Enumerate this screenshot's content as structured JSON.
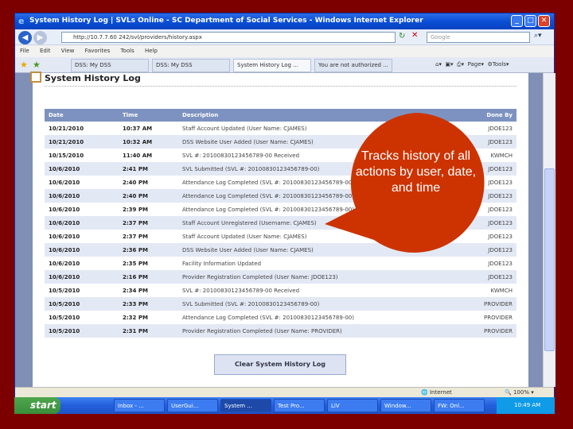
{
  "window": {
    "title": "System History Log | SVLs Online - SC Department of Social Services - Windows Internet Explorer",
    "url": "http://10.7.7.60 242/svl/providers/history.aspx",
    "search_placeholder": "Google"
  },
  "menu": [
    "File",
    "Edit",
    "View",
    "Favorites",
    "Tools",
    "Help"
  ],
  "tabs": [
    "DSS: My DSS",
    "DSS: My DSS",
    "System History Log ...",
    "You are not authorized ..."
  ],
  "toolbar": {
    "page": "Page",
    "tools": "Tools"
  },
  "page": {
    "title": "System History Log",
    "clear_button": "Clear System History Log"
  },
  "table": {
    "headers": [
      "Date",
      "Time",
      "Description",
      "Done By"
    ],
    "rows": [
      [
        "10/21/2010",
        "10:37 AM",
        "Staff Account Updated (User Name: CJAMES)",
        "JDOE123"
      ],
      [
        "10/21/2010",
        "10:32 AM",
        "DSS Website User Added (User Name: CJAMES)",
        "JDOE123"
      ],
      [
        "10/15/2010",
        "11:40 AM",
        "SVL #: 20100830123456789-00 Received",
        "KWMCH"
      ],
      [
        "10/6/2010",
        "2:41 PM",
        "SVL Submitted (SVL #: 20100830123456789-00)",
        "JDOE123"
      ],
      [
        "10/6/2010",
        "2:40 PM",
        "Attendance Log Completed (SVL #: 20100830123456789-00)",
        "JDOE123"
      ],
      [
        "10/6/2010",
        "2:40 PM",
        "Attendance Log Completed (SVL #: 20100830123456789-00)",
        "JDOE123"
      ],
      [
        "10/6/2010",
        "2:39 PM",
        "Attendance Log Completed (SVL #: 20100830123456789-00)",
        "JDOE123"
      ],
      [
        "10/6/2010",
        "2:37 PM",
        "Staff Account Unregistered (Username: CJAMES)",
        "JDOE123"
      ],
      [
        "10/6/2010",
        "2:37 PM",
        "Staff Account Updated (User Name: CJAMES)",
        "JDOE123"
      ],
      [
        "10/6/2010",
        "2:36 PM",
        "DSS Website User Added (User Name: CJAMES)",
        "JDOE123"
      ],
      [
        "10/6/2010",
        "2:35 PM",
        "Facility Information Updated",
        "JDOE123"
      ],
      [
        "10/6/2010",
        "2:16 PM",
        "Provider Registration Completed (User Name: JDOE123)",
        "JDOE123"
      ],
      [
        "10/5/2010",
        "2:34 PM",
        "SVL #: 20100830123456789-00 Received",
        "KWMCH"
      ],
      [
        "10/5/2010",
        "2:33 PM",
        "SVL Submitted (SVL #: 20100830123456789-00)",
        "PROVIDER"
      ],
      [
        "10/5/2010",
        "2:32 PM",
        "Attendance Log Completed (SVL #: 20100830123456789-00)",
        "PROVIDER"
      ],
      [
        "10/5/2010",
        "2:31 PM",
        "Provider Registration Completed (User Name: PROVIDER)",
        "PROVIDER"
      ]
    ]
  },
  "status": {
    "zone": "Internet",
    "zoom": "100%"
  },
  "taskbar": {
    "start": "start",
    "items": [
      "Inbox - ...",
      "UserGui...",
      "System ...",
      "Test Pro...",
      "LiV",
      "Window...",
      "FW: Onl..."
    ],
    "clock": "10:49 AM"
  },
  "callout": {
    "text": "Tracks history of all actions by user, date, and time",
    "color": "#cc3300"
  }
}
